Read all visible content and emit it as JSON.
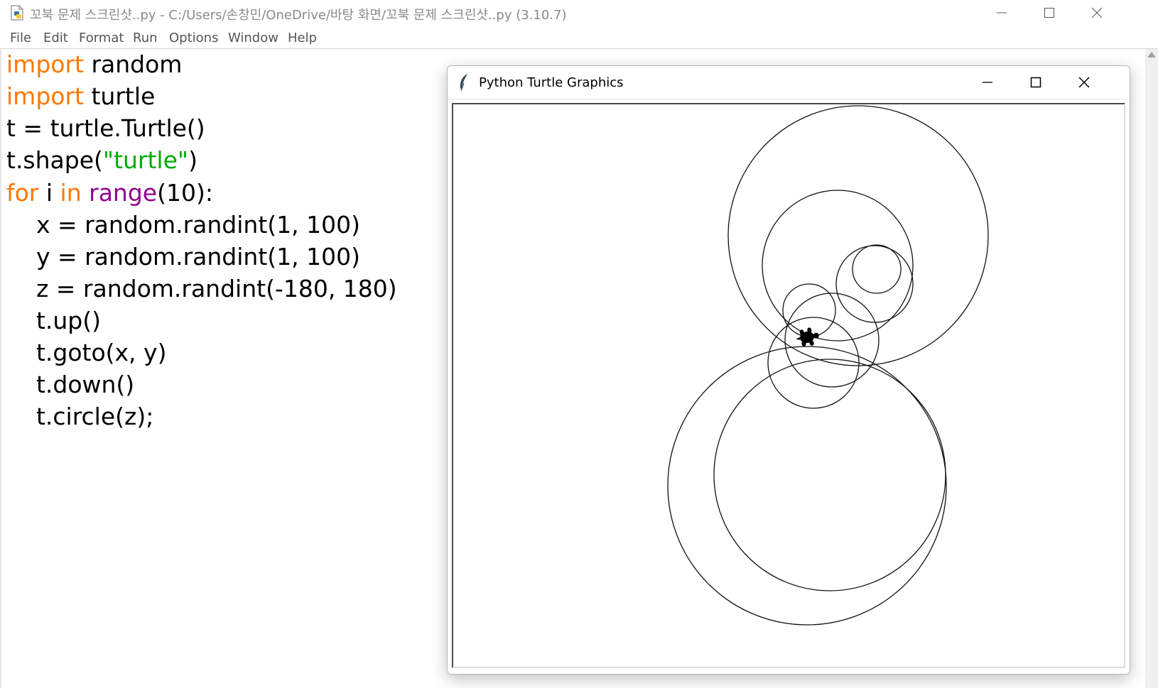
{
  "idle_window": {
    "title": "꼬북 문제 스크린샷..py - C:/Users/손창민/OneDrive/바탕 화면/꼬북 문제 스크린샷..py (3.10.7)"
  },
  "menu": {
    "items": [
      "File",
      "Edit",
      "Format",
      "Run",
      "Options",
      "Window",
      "Help"
    ]
  },
  "code_lines": [
    [
      {
        "t": "import",
        "c": "kw"
      },
      {
        "t": " random"
      }
    ],
    [
      {
        "t": "import",
        "c": "kw"
      },
      {
        "t": " turtle"
      }
    ],
    [
      {
        "t": "t = turtle.Turtle()"
      }
    ],
    [
      {
        "t": "t.shape("
      },
      {
        "t": "\"turtle\"",
        "c": "str"
      },
      {
        "t": ")"
      }
    ],
    [
      {
        "t": "for",
        "c": "kw"
      },
      {
        "t": " i "
      },
      {
        "t": "in",
        "c": "kw"
      },
      {
        "t": " "
      },
      {
        "t": "range",
        "c": "bi"
      },
      {
        "t": "(10):"
      }
    ],
    [
      {
        "t": "    x = random.randint(1, 100)"
      }
    ],
    [
      {
        "t": "    y = random.randint(1, 100)"
      }
    ],
    [
      {
        "t": "    z = random.randint(-180, 180)"
      }
    ],
    [
      {
        "t": "    t.up()"
      }
    ],
    [
      {
        "t": "    t.goto(x, y)"
      }
    ],
    [
      {
        "t": "    t.down()"
      }
    ],
    [
      {
        "t": "    t.circle(z);"
      }
    ]
  ],
  "turtle_window": {
    "title": "Python Turtle Graphics"
  },
  "colors": {
    "keyword": "#ff7700",
    "builtin": "#900090",
    "string": "#00aa00",
    "text": "#000000"
  }
}
